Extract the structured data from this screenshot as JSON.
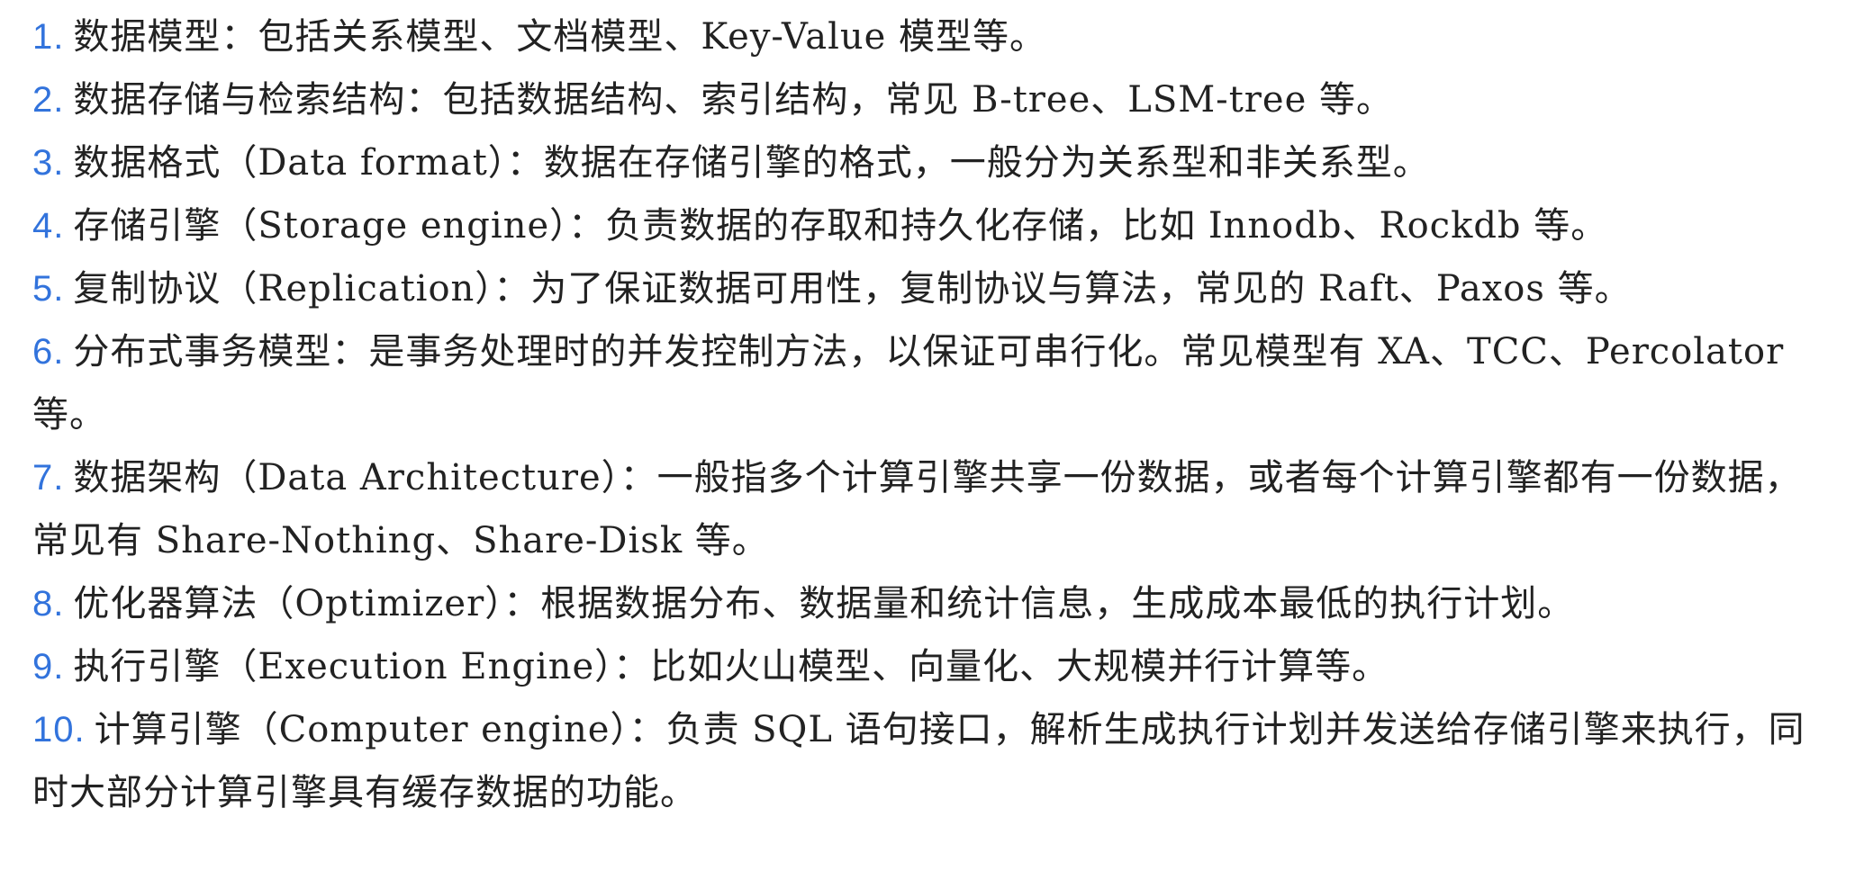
{
  "colors": {
    "number": "#3273dc",
    "text": "#222222",
    "background": "#ffffff"
  },
  "items": [
    {
      "num": "1.",
      "text": "数据模型：包括关系模型、文档模型、Key-Value 模型等。"
    },
    {
      "num": "2.",
      "text": "数据存储与检索结构：包括数据结构、索引结构，常见 B-tree、LSM-tree 等。"
    },
    {
      "num": "3.",
      "text": "数据格式（Data format）：数据在存储引擎的格式，一般分为关系型和非关系型。"
    },
    {
      "num": "4.",
      "text": "存储引擎（Storage engine）：负责数据的存取和持久化存储，比如 Innodb、Rockdb 等。"
    },
    {
      "num": "5.",
      "text": "复制协议（Replication）：为了保证数据可用性，复制协议与算法，常见的 Raft、Paxos 等。"
    },
    {
      "num": "6.",
      "text": "分布式事务模型：是事务处理时的并发控制方法，以保证可串行化。常见模型有 XA、TCC、Percolator 等。"
    },
    {
      "num": "7.",
      "text": "数据架构（Data Architecture）：一般指多个计算引擎共享一份数据，或者每个计算引擎都有一份数据，常见有 Share-Nothing、Share-Disk 等。"
    },
    {
      "num": "8.",
      "text": "优化器算法（Optimizer）：根据数据分布、数据量和统计信息，生成成本最低的执行计划。"
    },
    {
      "num": "9.",
      "text": "执行引擎（Execution Engine）：比如火山模型、向量化、大规模并行计算等。"
    },
    {
      "num": "10.",
      "text": "计算引擎（Computer engine）：负责 SQL 语句接口，解析生成执行计划并发送给存储引擎来执行，同时大部分计算引擎具有缓存数据的功能。"
    }
  ]
}
